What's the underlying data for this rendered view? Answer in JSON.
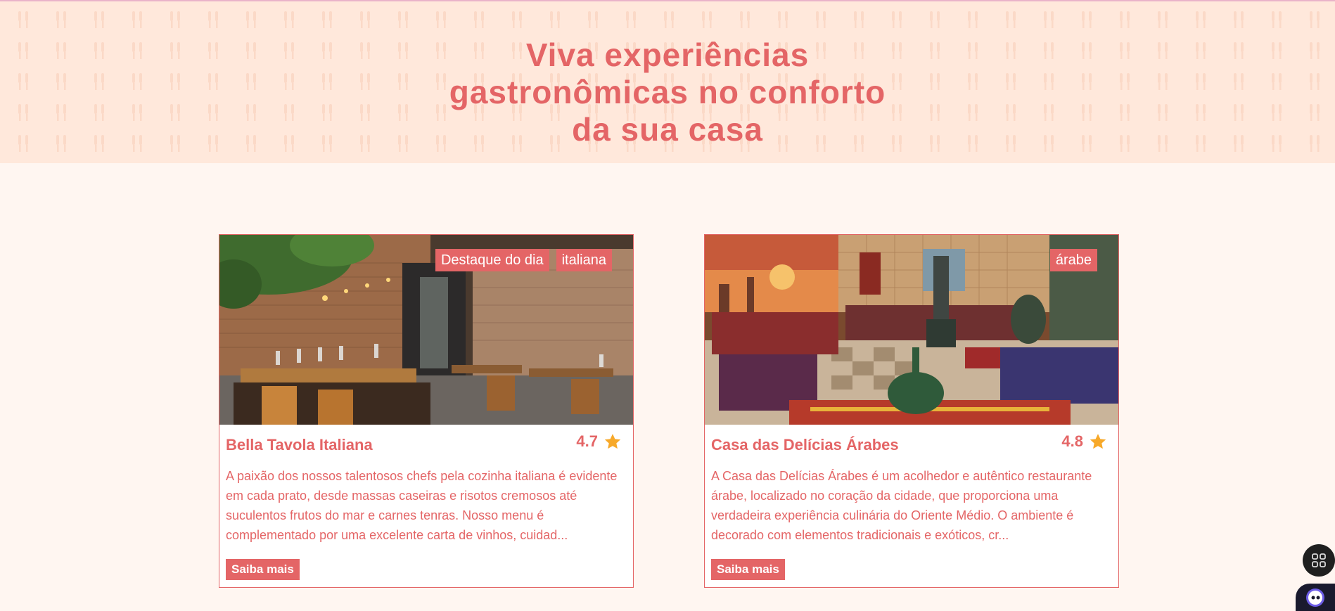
{
  "hero": {
    "title_lines": [
      "Viva experiências",
      "gastronômicas no conforto",
      "da sua casa"
    ]
  },
  "restaurants": [
    {
      "tags": [
        "Destaque do dia",
        "italiana"
      ],
      "name": "Bella Tavola Italiana",
      "rating": "4.7",
      "description": "A paixão dos nossos talentosos chefs pela cozinha italiana é evidente em cada prato, desde massas caseiras e risotos cremosos até suculentos frutos do mar e carnes tenras. Nosso menu é complementado por uma excelente carta de vinhos, cuidad...",
      "button_label": "Saiba mais"
    },
    {
      "tags": [
        "árabe"
      ],
      "name": "Casa das Delícias Árabes",
      "rating": "4.8",
      "description": "A Casa das Delícias Árabes é um acolhedor e autêntico restaurante árabe, localizado no coração da cidade, que proporciona uma verdadeira experiência culinária do Oriente Médio. O ambiente é decorado com elementos tradicionais e exóticos, cr...",
      "button_label": "Saiba mais"
    }
  ],
  "colors": {
    "accent": "#e46566",
    "hero_bg": "#ffe8db",
    "page_bg": "#fff6f1",
    "star": "#f7a92a"
  },
  "icons": {
    "rating": "star-icon",
    "widget": "grid-icon",
    "assistant": "assistant-bot-icon"
  }
}
